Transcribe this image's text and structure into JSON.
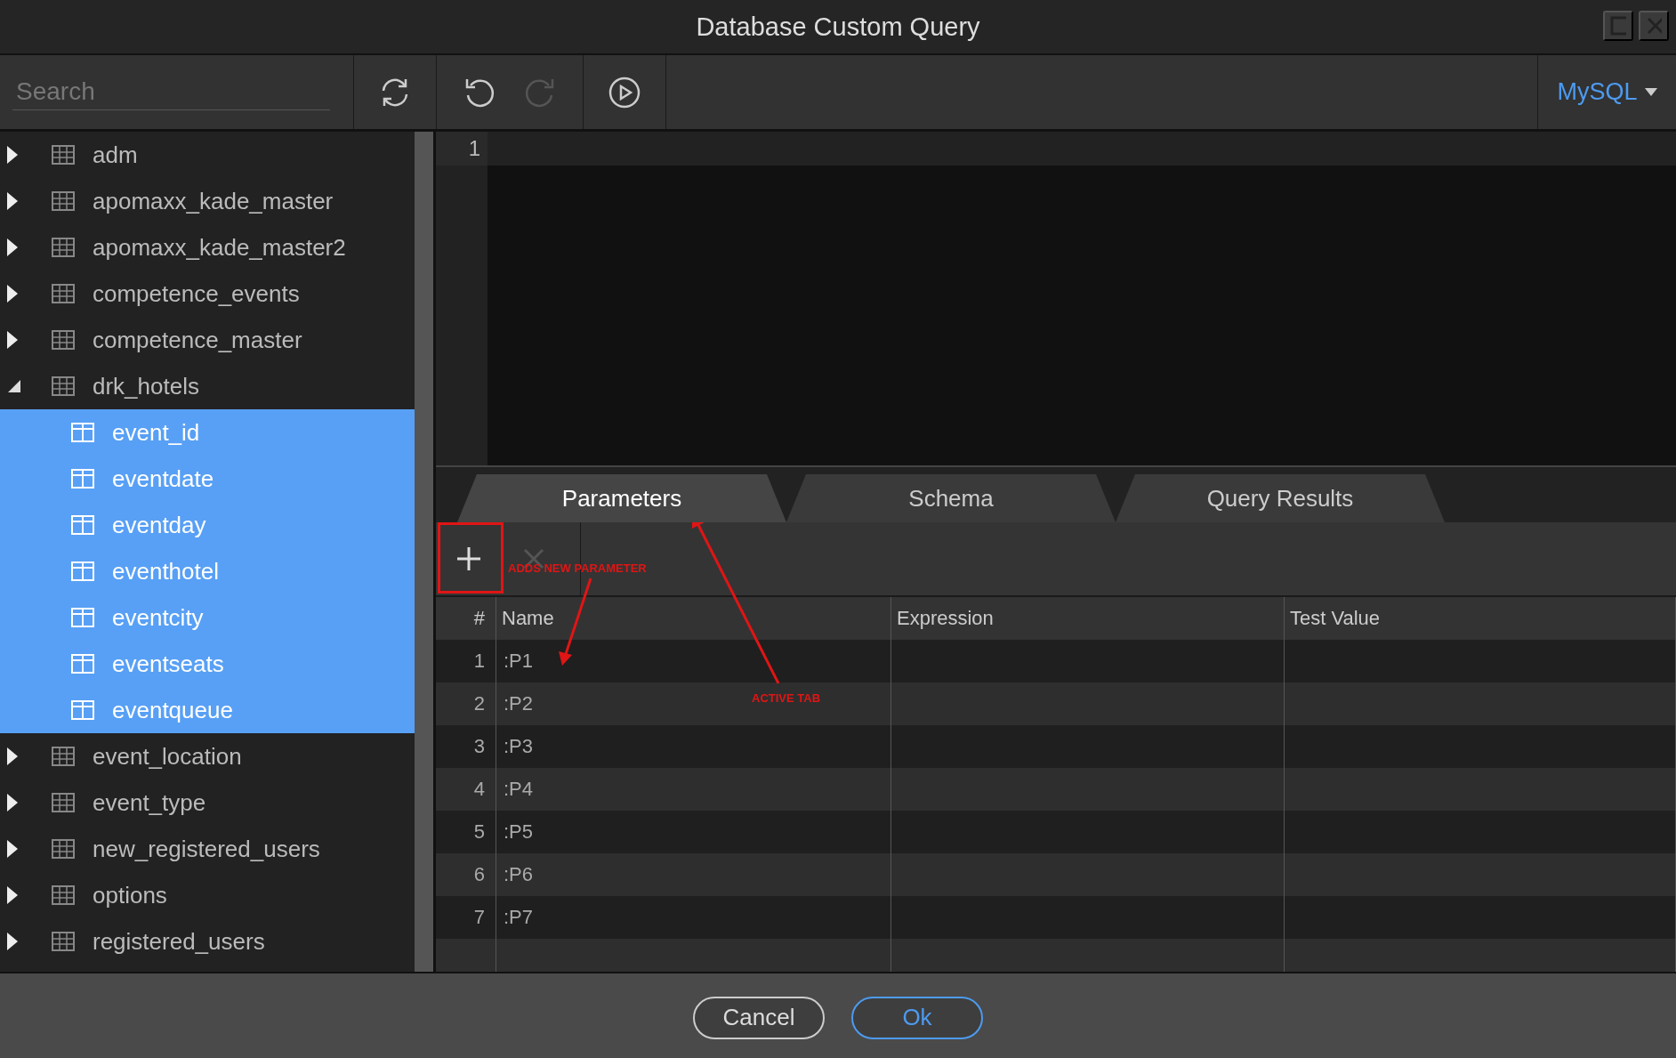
{
  "window": {
    "title": "Database Custom Query"
  },
  "toolbar": {
    "search": {
      "placeholder": "Search"
    },
    "undo": {
      "disabled": false
    },
    "redo": {
      "disabled": true
    },
    "dialect": "MySQL"
  },
  "tree": [
    {
      "label": "adm",
      "kind": "table",
      "expanded": false,
      "selected": false
    },
    {
      "label": "apomaxx_kade_master",
      "kind": "table",
      "expanded": false,
      "selected": false
    },
    {
      "label": "apomaxx_kade_master2",
      "kind": "table",
      "expanded": false,
      "selected": false
    },
    {
      "label": "competence_events",
      "kind": "table",
      "expanded": false,
      "selected": false
    },
    {
      "label": "competence_master",
      "kind": "table",
      "expanded": false,
      "selected": false
    },
    {
      "label": "drk_hotels",
      "kind": "table",
      "expanded": true,
      "selected": false,
      "children": [
        {
          "label": "event_id",
          "kind": "column",
          "selected": true
        },
        {
          "label": "eventdate",
          "kind": "column",
          "selected": true
        },
        {
          "label": "eventday",
          "kind": "column",
          "selected": true
        },
        {
          "label": "eventhotel",
          "kind": "column",
          "selected": true
        },
        {
          "label": "eventcity",
          "kind": "column",
          "selected": true
        },
        {
          "label": "eventseats",
          "kind": "column",
          "selected": true
        },
        {
          "label": "eventqueue",
          "kind": "column",
          "selected": true
        }
      ]
    },
    {
      "label": "event_location",
      "kind": "table",
      "expanded": false,
      "selected": false
    },
    {
      "label": "event_type",
      "kind": "table",
      "expanded": false,
      "selected": false
    },
    {
      "label": "new_registered_users",
      "kind": "table",
      "expanded": false,
      "selected": false
    },
    {
      "label": "options",
      "kind": "table",
      "expanded": false,
      "selected": false
    },
    {
      "label": "registered_users",
      "kind": "table",
      "expanded": false,
      "selected": false
    }
  ],
  "editor": {
    "line_numbers": [
      "1"
    ]
  },
  "tabs": [
    {
      "label": "Parameters",
      "selected": true
    },
    {
      "label": "Schema",
      "selected": false
    },
    {
      "label": "Query Results",
      "selected": false
    }
  ],
  "parameters": {
    "delete_disabled": true,
    "columns": [
      "#",
      "Name",
      "Expression",
      "Test Value"
    ],
    "rows": [
      {
        "index": "1",
        "name": ":P1"
      },
      {
        "index": "2",
        "name": ":P2"
      },
      {
        "index": "3",
        "name": ":P3"
      },
      {
        "index": "4",
        "name": ":P4"
      },
      {
        "index": "5",
        "name": ":P5"
      },
      {
        "index": "6",
        "name": ":P6"
      },
      {
        "index": "7",
        "name": ":P7"
      }
    ]
  },
  "annotations": [
    "ADDS NEW PARAMETER",
    "ACTIVE TAB"
  ],
  "buttons": [
    {
      "label": "Cancel",
      "kind": "secondary"
    },
    {
      "label": "Ok",
      "kind": "primary"
    }
  ]
}
